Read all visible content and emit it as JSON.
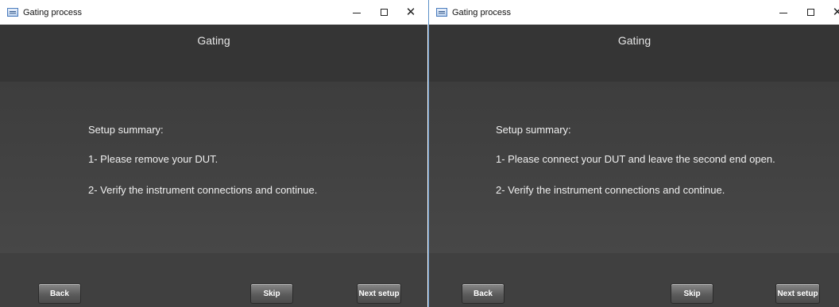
{
  "windows": [
    {
      "title": "Gating process",
      "header": "Gating",
      "summary_heading": "Setup summary:",
      "steps": [
        "1- Please remove your DUT.",
        "2- Verify the instrument connections and continue."
      ],
      "buttons": {
        "back": "Back",
        "skip": "Skip",
        "next": "Next setup"
      }
    },
    {
      "title": "Gating process",
      "header": "Gating",
      "summary_heading": "Setup summary:",
      "steps": [
        "1- Please connect your DUT and leave the second end open.",
        "2- Verify the instrument connections and continue."
      ],
      "buttons": {
        "back": "Back",
        "skip": "Skip",
        "next": "Next setup"
      }
    }
  ],
  "icons": {
    "minimize": "minimize-icon",
    "maximize": "maximize-icon",
    "close": "close-icon",
    "app": "app-icon"
  },
  "colors": {
    "background": "#3a3a3a",
    "text": "#f0f0f0",
    "titlebar": "#ffffff"
  }
}
